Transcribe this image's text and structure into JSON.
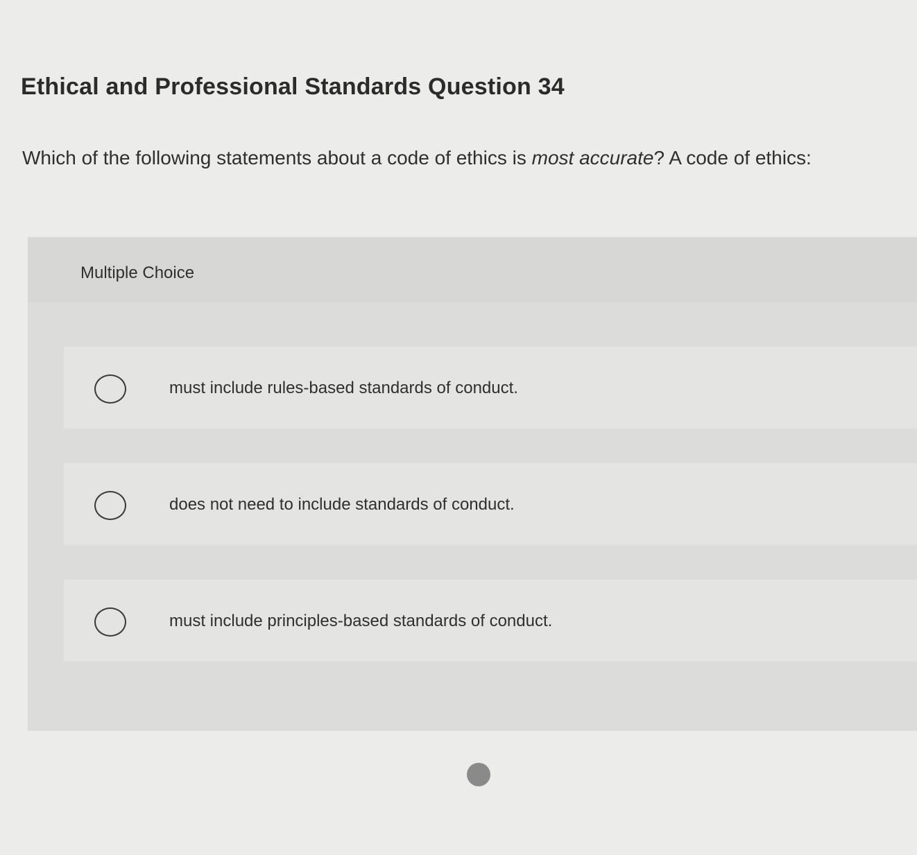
{
  "page": {
    "title": "Ethical and Professional Standards Question 34"
  },
  "question": {
    "text_before": "Which of the following statements about a code of ethics is ",
    "emphasis": "most accurate",
    "text_after": "? A code of ethics:"
  },
  "multiple_choice": {
    "label": "Multiple Choice",
    "options": [
      {
        "text": "must include rules-based standards of conduct.",
        "selected": false
      },
      {
        "text": "does not need to include standards of conduct.",
        "selected": false
      },
      {
        "text": "must include principles-based standards of conduct.",
        "selected": false
      }
    ]
  },
  "pagination": {
    "indicator": "dot"
  }
}
